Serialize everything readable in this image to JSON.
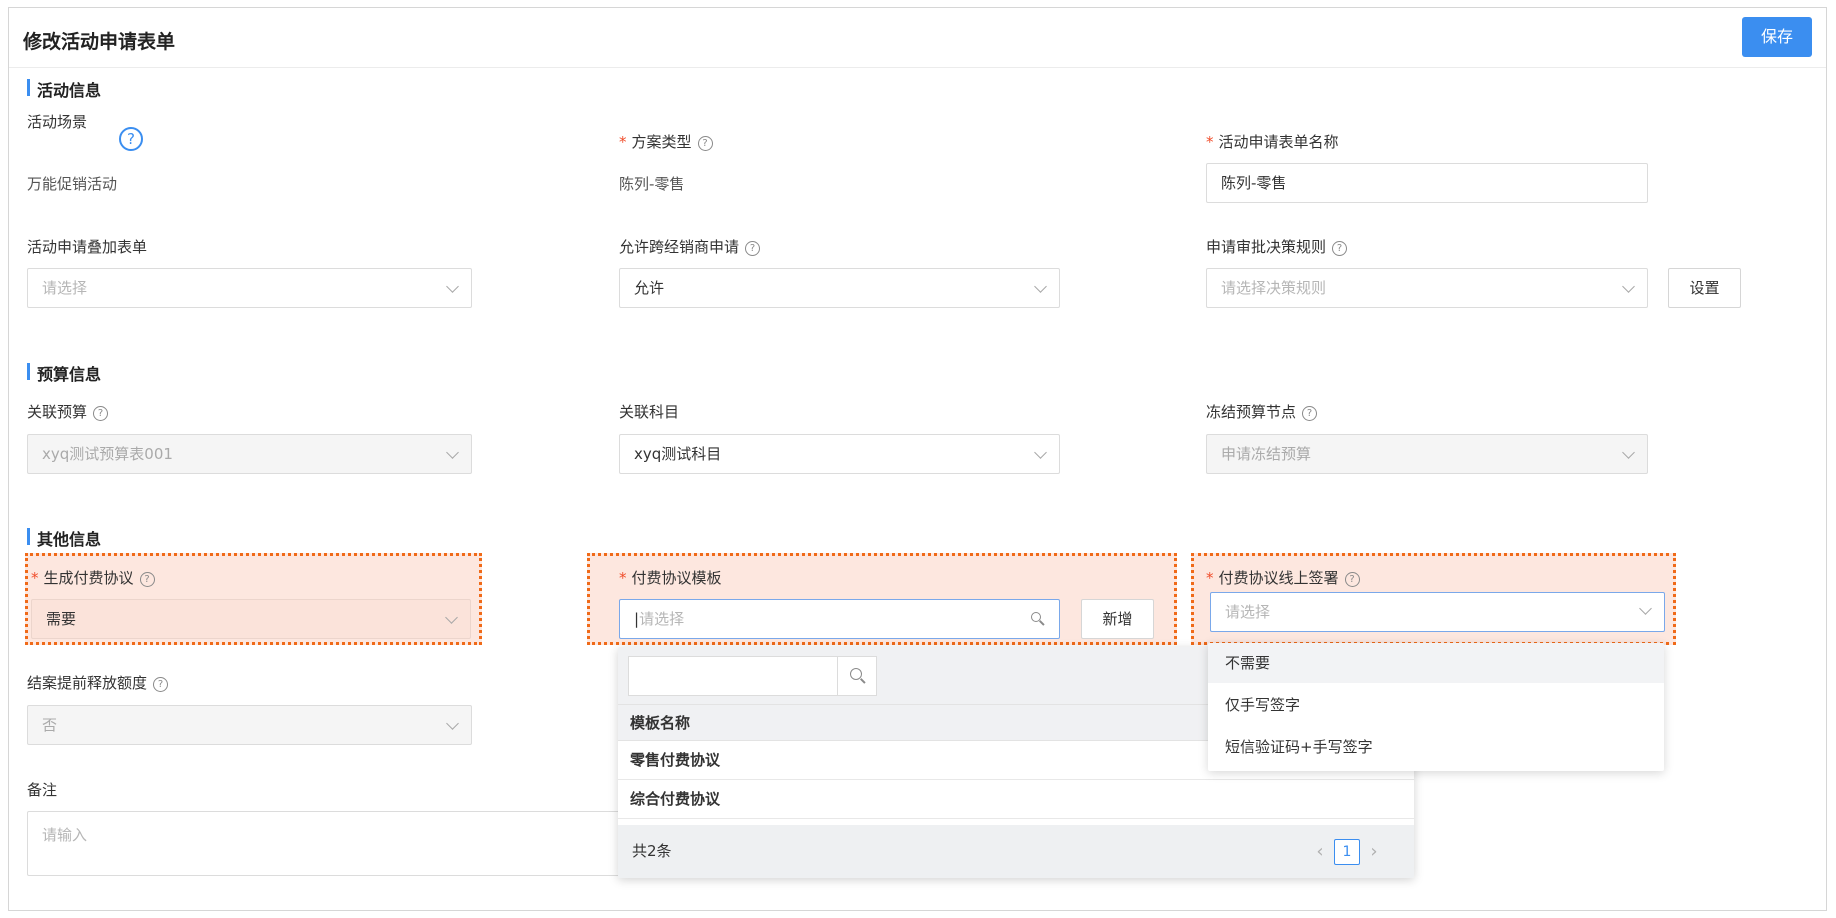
{
  "header": {
    "title": "修改活动申请表单",
    "save_label": "保存"
  },
  "sections": {
    "activity": "活动信息",
    "budget": "预算信息",
    "other": "其他信息"
  },
  "activity": {
    "scene_label": "活动场景",
    "scene_value": "万能促销活动",
    "plan_type_label": "方案类型",
    "plan_type_value": "陈列-零售",
    "form_name_label": "活动申请表单名称",
    "form_name_value": "陈列-零售",
    "overlay_label": "活动申请叠加表单",
    "overlay_placeholder": "请选择",
    "cross_dealer_label": "允许跨经销商申请",
    "cross_dealer_value": "允许",
    "approval_rule_label": "申请审批决策规则",
    "approval_rule_placeholder": "请选择决策规则",
    "settings_label": "设置"
  },
  "budget": {
    "linked_budget_label": "关联预算",
    "linked_budget_value": "xyq测试预算表001",
    "linked_account_label": "关联科目",
    "linked_account_value": "xyq测试科目",
    "freeze_node_label": "冻结预算节点",
    "freeze_node_value": "申请冻结预算"
  },
  "other": {
    "gen_agreement_label": "生成付费协议",
    "gen_agreement_value": "需要",
    "template_label": "付费协议模板",
    "template_placeholder": "请选择",
    "add_label": "新增",
    "online_sign_label": "付费协议线上签署",
    "online_sign_placeholder": "请选择",
    "release_label": "结案提前释放额度",
    "release_value": "否",
    "remark_label": "备注",
    "remark_placeholder": "请输入"
  },
  "template_popup": {
    "column_header": "模板名称",
    "rows": [
      "零售付费协议",
      "综合付费协议"
    ],
    "total_text": "共2条",
    "current_page": "1"
  },
  "sign_dropdown": {
    "options": [
      "不需要",
      "仅手写签字",
      "短信验证码+手写签字"
    ]
  },
  "colors": {
    "accent": "#3b8ef0",
    "required": "#f04d2b",
    "highlight_border": "#f06a18",
    "highlight_fill": "#fde7df"
  }
}
